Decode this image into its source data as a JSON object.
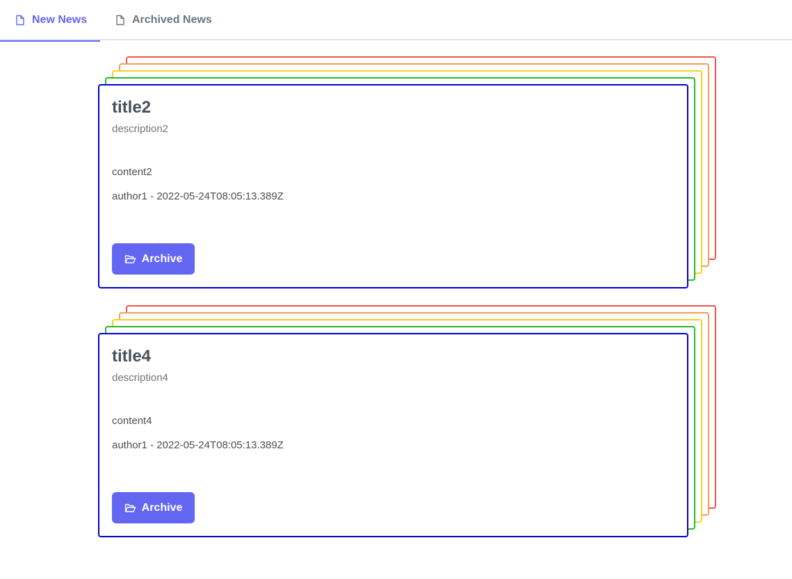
{
  "tabs": [
    {
      "label": "New News",
      "icon": "file-icon",
      "active": true
    },
    {
      "label": "Archived News",
      "icon": "file-icon",
      "active": false
    }
  ],
  "colors": {
    "accent": "#6366f1",
    "stack_borders": [
      "#ef5350",
      "#f0a050",
      "#f5d020",
      "#22bb22",
      "#0000cc"
    ]
  },
  "news": [
    {
      "title": "title2",
      "description": "description2",
      "content": "content2",
      "meta": "author1 - 2022-05-24T08:05:13.389Z",
      "button_label": "Archive",
      "button_icon": "folder-open-icon"
    },
    {
      "title": "title4",
      "description": "description4",
      "content": "content4",
      "meta": "author1 - 2022-05-24T08:05:13.389Z",
      "button_label": "Archive",
      "button_icon": "folder-open-icon"
    }
  ]
}
